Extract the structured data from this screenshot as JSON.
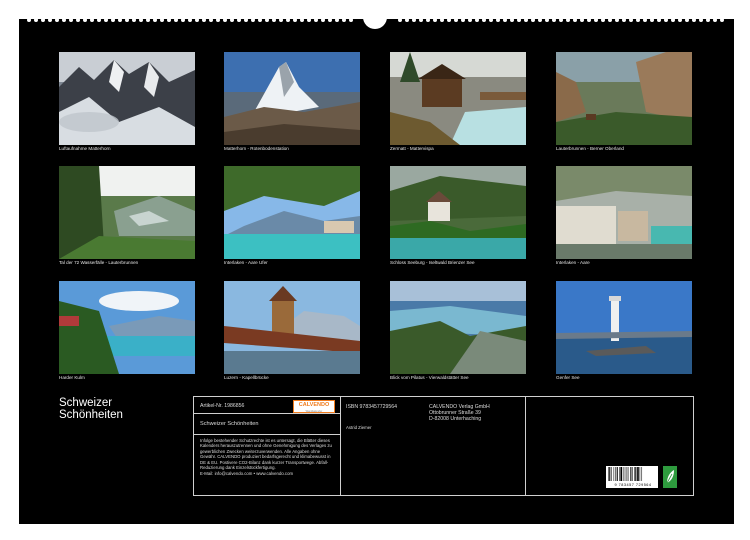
{
  "calendar": {
    "title_line1": "Schweizer",
    "title_line2": "Schönheiten",
    "photos": [
      {
        "caption": "Luftaufnahme Matterhorn",
        "scene": "cloudy-peaks"
      },
      {
        "caption": "Matterhorn - Rotenbodenstation",
        "scene": "matterhorn"
      },
      {
        "caption": "Zermatt - Mattervispa",
        "scene": "wooden-hut-river"
      },
      {
        "caption": "Lauterbrunnen - Berner Oberland",
        "scene": "valley-cliffs"
      },
      {
        "caption": "Tal der 72 Wasserfälle - Lauterbrunnen",
        "scene": "green-valley"
      },
      {
        "caption": "Interlaken - Aare Ufer",
        "scene": "turquoise-river"
      },
      {
        "caption": "Schloss Seeburg - Iseltwald Brienzer See",
        "scene": "castle-lake"
      },
      {
        "caption": "Interlaken - Aare",
        "scene": "town-river"
      },
      {
        "caption": "Harder Kulm",
        "scene": "lake-view"
      },
      {
        "caption": "Luzern - Kapellbrücke",
        "scene": "chapel-bridge"
      },
      {
        "caption": "Blick vom Pilatus - Vierwaldstätter See",
        "scene": "lake-mountains"
      },
      {
        "caption": "Genfer See",
        "scene": "lighthouse"
      }
    ],
    "info": {
      "article_label": "Artikel-Nr. 1986856",
      "logo_text": "CALVENDO",
      "logo_sub": "Wandkalender",
      "product_title": "Schweizer Schönheiten",
      "legal_text": "Infolge bestehender Schutzrechte ist es untersagt, die Blätter dieses Kalenders herauszutrennen und ohne Genehmigung des Verlages zu gewerblichen Zwecken weiterzuverwenden. Alle Angaben ohne Gewähr. CALVENDO produziert bedarfsgerecht und klimabewusst in DE & EU. Postivere CO2-Bilanz dank kurzer Transportwege. Abfall-Reduzierung dank Einzelstückfertigung.",
      "email_line": "E-Mail: info@calvendo.com • www.calvendo.com",
      "isbn": "ISBN 9783457729564",
      "author": "Astrid Ziemer",
      "publisher_name": "CALVENDO Verlag GmbH",
      "publisher_street": "Ottobrunner Straße 39",
      "publisher_city": "D-82008 Unterhaching",
      "barcode_number": "9 783457 729564"
    }
  }
}
